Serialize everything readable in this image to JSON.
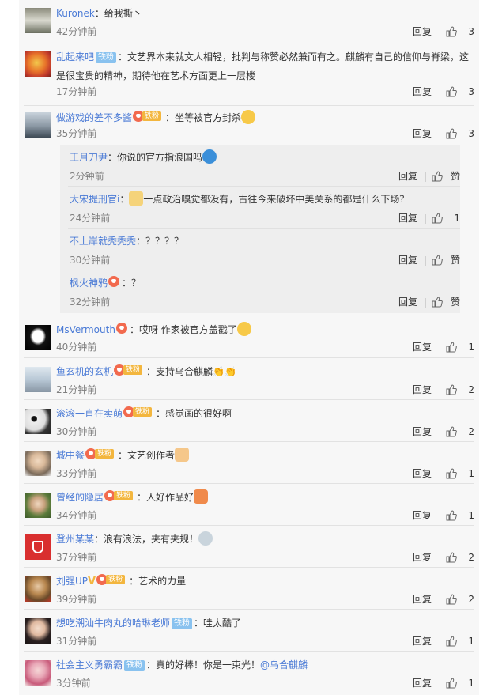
{
  "ui": {
    "reply_label": "回复",
    "like_empty": "赞",
    "fan_badge": "铁粉",
    "fans_badge_text": "铁粉"
  },
  "colors": {
    "link": "#4b7bd6",
    "fan_badge": "#f3b63e",
    "heart": "#f26a4e",
    "vip_badge": "#89c2ef"
  },
  "comments": [
    {
      "user": "Kuronek",
      "text": "：给我撕丶",
      "time": "42分钟前",
      "likes": "3",
      "avatar": "avatar-photo"
    },
    {
      "user": "乱起来吧",
      "badge": "铁粉",
      "text": "：文艺界本来就文人相轻，批判与称赞必然兼而有之。麒麟有自己的信仰与脊梁，这是很宝贵的精神，期待他在艺术方面更上一层楼",
      "time": "17分钟前",
      "likes": "3"
    },
    {
      "user": "做游戏的差不多酱",
      "text": "：坐等被官方封杀",
      "time": "35分钟前",
      "likes": "3"
    },
    {
      "user": "MsVermouth",
      "text": "：哎呀 作家被官方盖戳了",
      "time": "40分钟前",
      "likes": "1"
    },
    {
      "user": "鱼玄机的玄机",
      "text": "：支持乌合麒麟",
      "time": "21分钟前",
      "likes": "2"
    },
    {
      "user": "滚滚一直在卖萌",
      "text": "：感觉画的很好啊",
      "time": "30分钟前",
      "likes": "2"
    },
    {
      "user": "城中餐",
      "text": "：文艺创作者",
      "time": "33分钟前",
      "likes": "1"
    },
    {
      "user": "曾经的隐居",
      "text": "：人好作品好",
      "time": "34分钟前",
      "likes": "1"
    },
    {
      "user": "登州某某",
      "text": "：浪有浪法，夹有夹规！",
      "time": "37分钟前",
      "likes": "2"
    },
    {
      "user": "刘强UP",
      "text": "：艺术的力量",
      "time": "39分钟前",
      "likes": "2"
    },
    {
      "user": "想吃潮汕牛肉丸的哈琳老师",
      "badge": "铁粉",
      "text": "：哇太酷了",
      "time": "31分钟前",
      "likes": "1"
    },
    {
      "user": "社会主义勇霸霸",
      "badge": "铁粉",
      "text_before": "：真的好棒！你是一束光！",
      "mention": "@乌合麒麟",
      "time": "3分钟前",
      "likes": "1"
    }
  ],
  "replies": [
    {
      "user": "王月刀尹",
      "text": "：你说的官方指浪国吗",
      "time": "2分钟前",
      "likes": "赞"
    },
    {
      "user": "大宋提刑官i",
      "text": "一点政治嗅觉都没有，古往今来破坏中美关系的都是什么下场？",
      "time": "24分钟前",
      "likes": "1"
    },
    {
      "user": "不上岸就秃秃秃",
      "text": "：？？？？",
      "time": "30分钟前",
      "likes": "赞"
    },
    {
      "user": "枫火神鸦",
      "text": "：？",
      "time": "32分钟前",
      "likes": "赞"
    }
  ]
}
